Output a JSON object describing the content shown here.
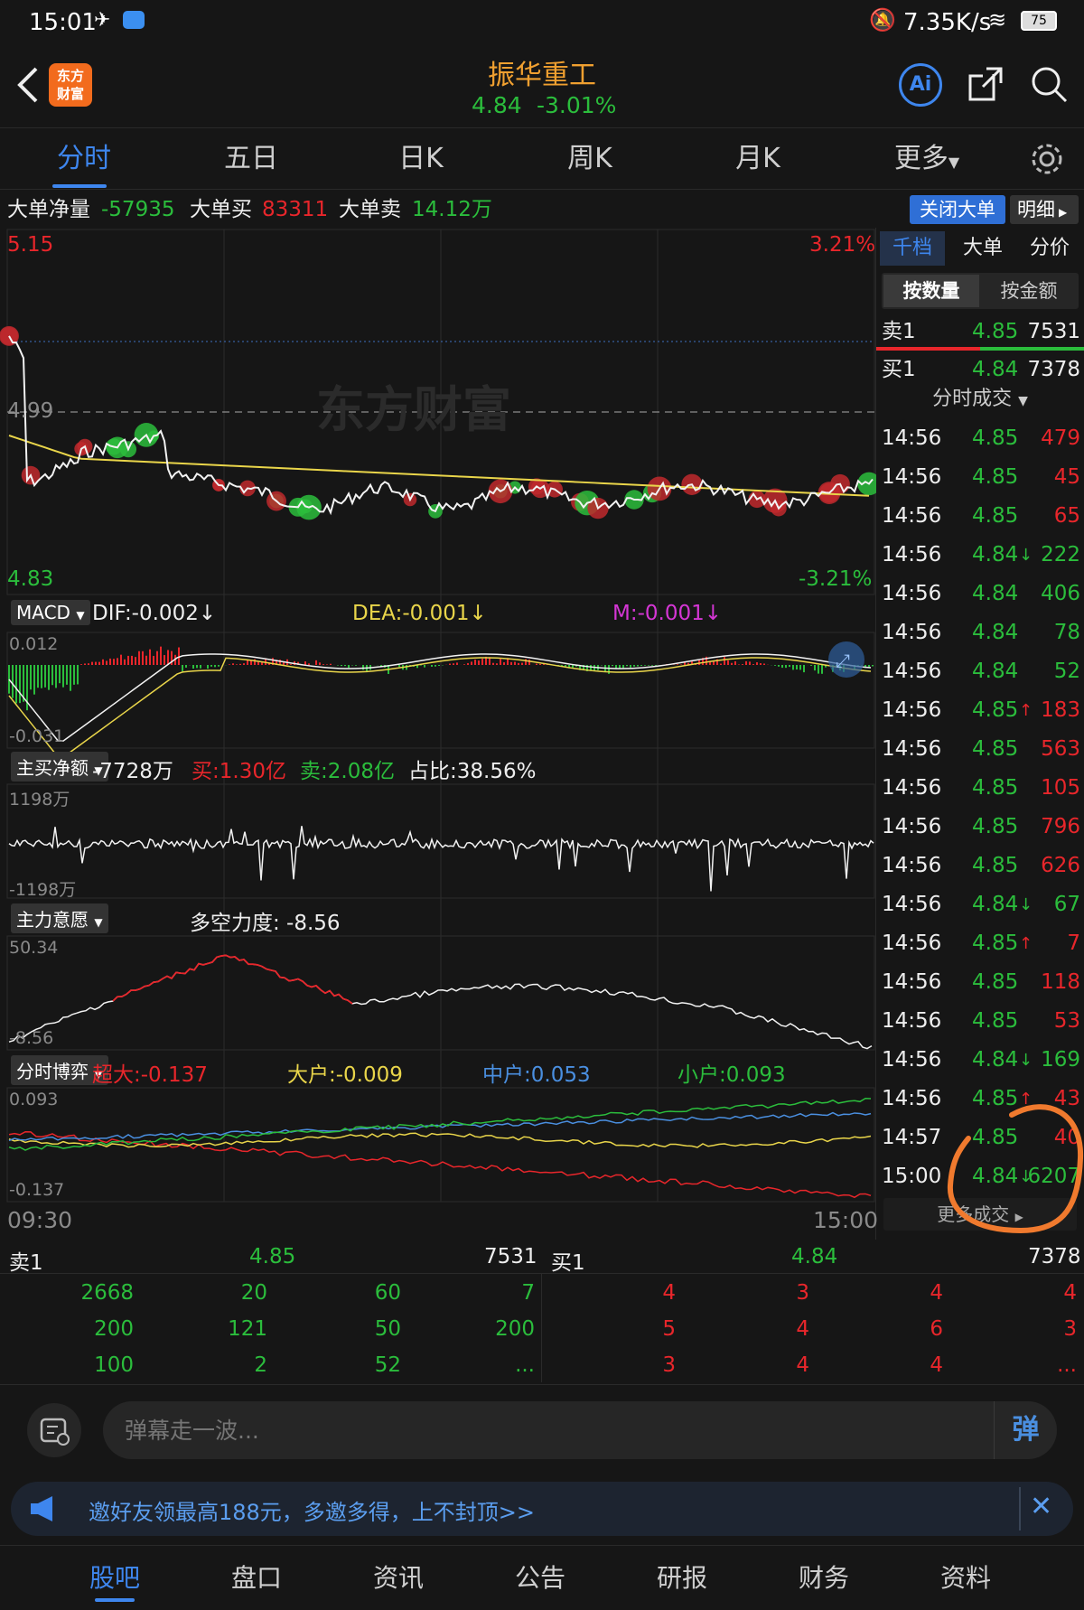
{
  "status": {
    "time": "15:01",
    "speed": "7.35K/s",
    "battery": "75"
  },
  "header": {
    "logo": "东方\n财富",
    "title": "振华重工",
    "price": "4.84",
    "change": "-3.01%",
    "ai": "Ai"
  },
  "tabs": [
    "分时",
    "五日",
    "日K",
    "周K",
    "月K",
    "更多"
  ],
  "bigorder": {
    "net_label": "大单净量",
    "net": "-57935",
    "buy_label": "大单买",
    "buy": "83311",
    "sell_label": "大单卖",
    "sell": "14.12万",
    "close_btn": "关闭大单",
    "detail_btn": "明细"
  },
  "price_chart": {
    "high": "5.15",
    "high_pct": "3.21%",
    "prev": "4.99",
    "low": "4.83",
    "low_pct": "-3.21%",
    "watermark": "东方财富"
  },
  "macd": {
    "label": "MACD",
    "dif": "DIF:-0.002↓",
    "dea": "DEA:-0.001↓",
    "m": "M:-0.001↓",
    "top": "0.012",
    "bottom": "-0.031"
  },
  "net_buy": {
    "label": "主买净额",
    "value": "-7728万",
    "buy": "买:1.30亿",
    "sell": "卖:2.08亿",
    "ratio": "占比:38.56%",
    "top": "1198万",
    "bottom": "-1198万"
  },
  "intent": {
    "label": "主力意愿",
    "power": "多空力度: -8.56",
    "top": "50.34",
    "bottom": "-8.56"
  },
  "game": {
    "label": "分时博弈",
    "super": "超大:-0.137",
    "large": "大户:-0.009",
    "mid": "中户:0.053",
    "small": "小户:0.093",
    "top": "0.093",
    "bottom": "-0.137"
  },
  "time_axis": {
    "start": "09:30",
    "end": "15:00"
  },
  "right": {
    "tabs": [
      "千档",
      "大单",
      "分价"
    ],
    "sub": [
      "按数量",
      "按金额"
    ],
    "ask1": {
      "label": "卖1",
      "price": "4.85",
      "vol": "7531"
    },
    "bid1": {
      "label": "买1",
      "price": "4.84",
      "vol": "7378"
    },
    "trades_title": "分时成交",
    "more": "更多成交"
  },
  "trades": [
    {
      "t": "14:56",
      "p": "4.85",
      "a": "",
      "v": "479",
      "c": "r"
    },
    {
      "t": "14:56",
      "p": "4.85",
      "a": "",
      "v": "45",
      "c": "r"
    },
    {
      "t": "14:56",
      "p": "4.85",
      "a": "",
      "v": "65",
      "c": "r"
    },
    {
      "t": "14:56",
      "p": "4.84",
      "a": "↓",
      "v": "222",
      "c": "g"
    },
    {
      "t": "14:56",
      "p": "4.84",
      "a": "",
      "v": "406",
      "c": "g"
    },
    {
      "t": "14:56",
      "p": "4.84",
      "a": "",
      "v": "78",
      "c": "g"
    },
    {
      "t": "14:56",
      "p": "4.84",
      "a": "",
      "v": "52",
      "c": "g"
    },
    {
      "t": "14:56",
      "p": "4.85",
      "a": "↑",
      "v": "183",
      "c": "r"
    },
    {
      "t": "14:56",
      "p": "4.85",
      "a": "",
      "v": "563",
      "c": "r"
    },
    {
      "t": "14:56",
      "p": "4.85",
      "a": "",
      "v": "105",
      "c": "r"
    },
    {
      "t": "14:56",
      "p": "4.85",
      "a": "",
      "v": "796",
      "c": "r"
    },
    {
      "t": "14:56",
      "p": "4.85",
      "a": "",
      "v": "626",
      "c": "r"
    },
    {
      "t": "14:56",
      "p": "4.84",
      "a": "↓",
      "v": "67",
      "c": "g"
    },
    {
      "t": "14:56",
      "p": "4.85",
      "a": "↑",
      "v": "7",
      "c": "r"
    },
    {
      "t": "14:56",
      "p": "4.85",
      "a": "",
      "v": "118",
      "c": "r"
    },
    {
      "t": "14:56",
      "p": "4.85",
      "a": "",
      "v": "53",
      "c": "r"
    },
    {
      "t": "14:56",
      "p": "4.84",
      "a": "↓",
      "v": "169",
      "c": "g"
    },
    {
      "t": "14:56",
      "p": "4.85",
      "a": "↑",
      "v": "43",
      "c": "r"
    },
    {
      "t": "14:57",
      "p": "4.85",
      "a": "",
      "v": "40",
      "c": "r"
    },
    {
      "t": "15:00",
      "p": "4.84",
      "a": "↓",
      "v": "6207",
      "c": "g"
    }
  ],
  "orderbook": {
    "ask_label": "卖1",
    "ask_price": "4.85",
    "ask_vol": "7531",
    "bid_label": "买1",
    "bid_price": "4.84",
    "bid_vol": "7378",
    "ask_rows": [
      [
        "2668",
        "20",
        "60",
        "7"
      ],
      [
        "200",
        "121",
        "50",
        "200"
      ],
      [
        "100",
        "2",
        "52",
        "..."
      ]
    ],
    "bid_rows": [
      [
        "4",
        "3",
        "4",
        "4"
      ],
      [
        "5",
        "4",
        "6",
        "3"
      ],
      [
        "3",
        "4",
        "4",
        "..."
      ]
    ]
  },
  "danmu": {
    "placeholder": "弹幕走一波...",
    "btn": "弹"
  },
  "promo": {
    "text": "邀好友领最高188元，多邀多得，上不封顶>>"
  },
  "nav": [
    "股吧",
    "盘口",
    "资讯",
    "公告",
    "研报",
    "财务",
    "资料"
  ]
}
